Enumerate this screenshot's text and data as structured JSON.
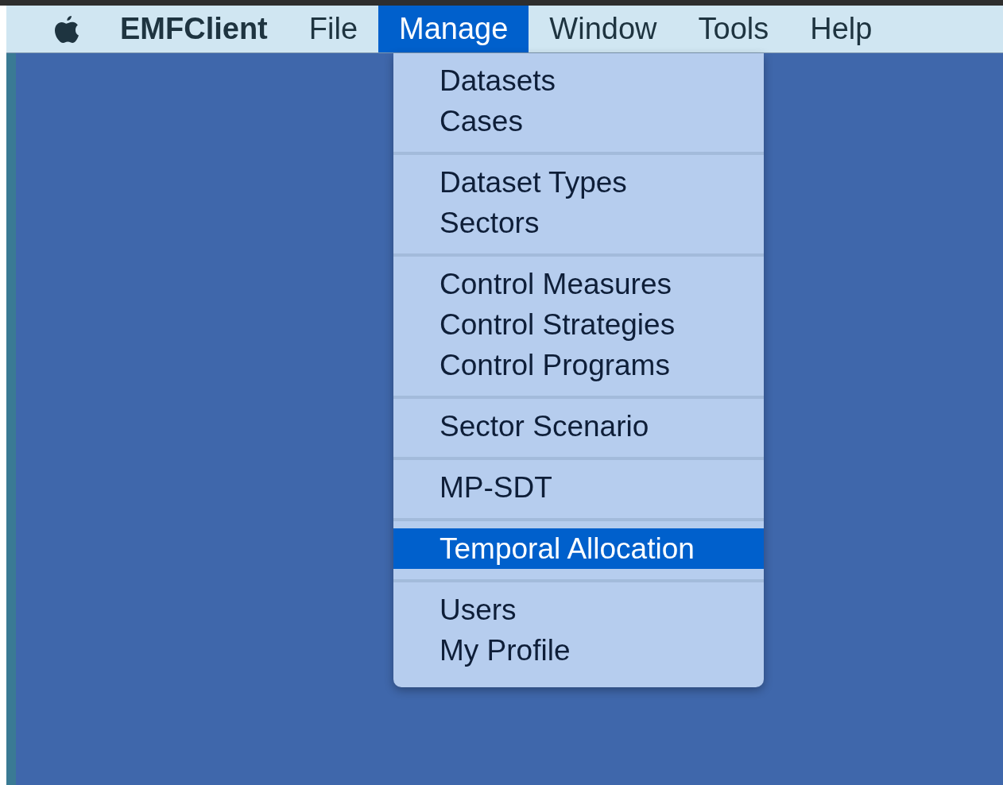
{
  "menubar": {
    "app_name": "EMFClient",
    "menus": [
      {
        "label": "File",
        "selected": false
      },
      {
        "label": "Manage",
        "selected": true
      },
      {
        "label": "Window",
        "selected": false
      },
      {
        "label": "Tools",
        "selected": false
      },
      {
        "label": "Help",
        "selected": false
      }
    ]
  },
  "dropdown": {
    "groups": [
      [
        {
          "label": "Datasets",
          "selected": false
        },
        {
          "label": "Cases",
          "selected": false
        }
      ],
      [
        {
          "label": "Dataset Types",
          "selected": false
        },
        {
          "label": "Sectors",
          "selected": false
        }
      ],
      [
        {
          "label": "Control Measures",
          "selected": false
        },
        {
          "label": "Control Strategies",
          "selected": false
        },
        {
          "label": "Control Programs",
          "selected": false
        }
      ],
      [
        {
          "label": "Sector Scenario",
          "selected": false
        }
      ],
      [
        {
          "label": "MP-SDT",
          "selected": false
        }
      ],
      [
        {
          "label": "Temporal Allocation",
          "selected": true
        }
      ],
      [
        {
          "label": "Users",
          "selected": false
        },
        {
          "label": "My Profile",
          "selected": false
        }
      ]
    ]
  }
}
